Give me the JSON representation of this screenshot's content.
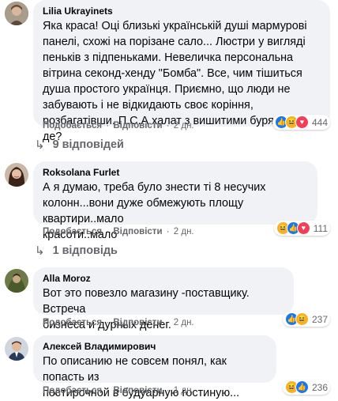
{
  "ui": {
    "like_label": "Подобається",
    "reply_label": "Відповісти",
    "dot": "·"
  },
  "comments": [
    {
      "author": "Lilia Ukrayinets",
      "text_lines": [
        "Яка краса! Оці близькі українській душі мармурові",
        "панелі, схожі на порізане сало... Люстри у вигляді",
        "пеньків з підпеньками. Невеличка персональна",
        "вітрина секонд-хенду \"Бомба\". Все, чим тішиться",
        "душа простого українця. Приємно, що люди не",
        "забувають і не відкидають своє коріння,",
        "розбагатівши. П.С.А халат з вишитими бурячками де?"
      ],
      "time": "2 дн.",
      "reaction_count": "444",
      "reactions": [
        "like",
        "haha",
        "love"
      ],
      "replies_label": "9 відповідей"
    },
    {
      "author": "Roksolana Furlet",
      "text_lines": [
        "А я думаю, треба було знести ті 8 несучих",
        "колонн...вони дуже обмежують площу квартири..мало",
        "красоти..мало"
      ],
      "time": "2 дн.",
      "reaction_count": "111",
      "reactions": [
        "haha",
        "like",
        "love"
      ],
      "replies_label": "1 відповідь"
    },
    {
      "author": "Alla Moroz",
      "text_lines": [
        "Вот это повезло магазину -поставщику. Встреча",
        "бизнеса и дурных денег."
      ],
      "time": "2 дн.",
      "reaction_count": "237",
      "reactions": [
        "like",
        "haha"
      ]
    },
    {
      "author": "Алексей Владимирович",
      "text_lines": [
        "По описанию не совсем понял, как попасть из",
        "постирочной в будуарную гостиную..."
      ],
      "time": "1 дн.",
      "reaction_count": "236",
      "reactions": [
        "haha",
        "like"
      ]
    }
  ]
}
